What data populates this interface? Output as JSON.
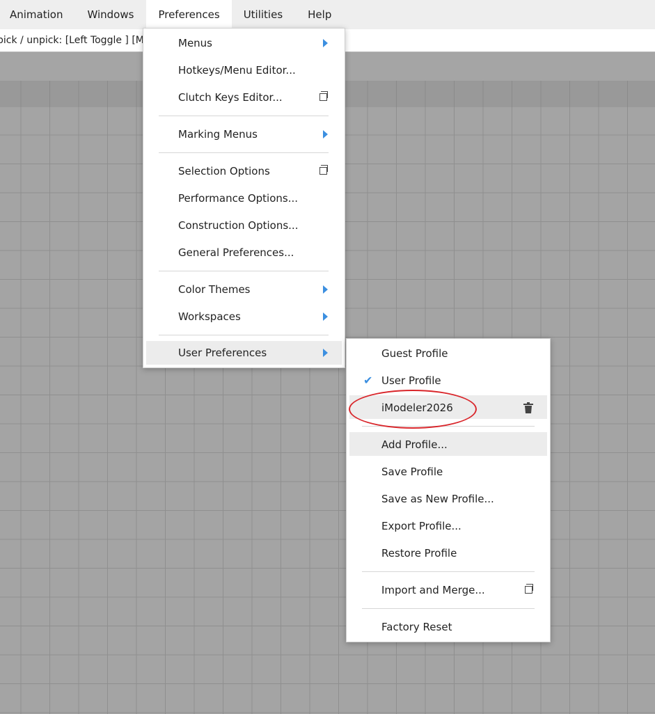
{
  "menubar": {
    "items": [
      "Animation",
      "Windows",
      "Preferences",
      "Utilities",
      "Help"
    ],
    "active": "Preferences"
  },
  "helpline": {
    "text": "pick / unpick: [Left Toggle ] [Mi"
  },
  "preferences_menu": {
    "items": [
      {
        "label": "Menus",
        "submenu": true
      },
      {
        "label": "Hotkeys/Menu Editor..."
      },
      {
        "label": "Clutch Keys Editor...",
        "option_box": true
      },
      {
        "label": "Marking Menus",
        "submenu": true
      },
      {
        "label": "Selection Options",
        "option_box": true
      },
      {
        "label": "Performance Options..."
      },
      {
        "label": "Construction Options..."
      },
      {
        "label": "General Preferences..."
      },
      {
        "label": "Color Themes",
        "submenu": true
      },
      {
        "label": "Workspaces",
        "submenu": true
      },
      {
        "label": "User Preferences",
        "submenu": true,
        "highlighted": true
      }
    ]
  },
  "user_prefs_menu": {
    "items": [
      {
        "label": "Guest Profile"
      },
      {
        "label": "User Profile",
        "checked": true
      },
      {
        "label": "iModeler2026",
        "icon": "trash-icon",
        "annotated": true
      },
      {
        "label": "Add Profile...",
        "highlighted": true
      },
      {
        "label": "Save Profile"
      },
      {
        "label": "Save as New Profile..."
      },
      {
        "label": "Export Profile..."
      },
      {
        "label": "Restore Profile"
      },
      {
        "label": "Import and Merge...",
        "option_box": true
      },
      {
        "label": "Factory Reset"
      }
    ]
  },
  "colors": {
    "accent": "#3c8fe0",
    "annotation": "#d9262b"
  }
}
